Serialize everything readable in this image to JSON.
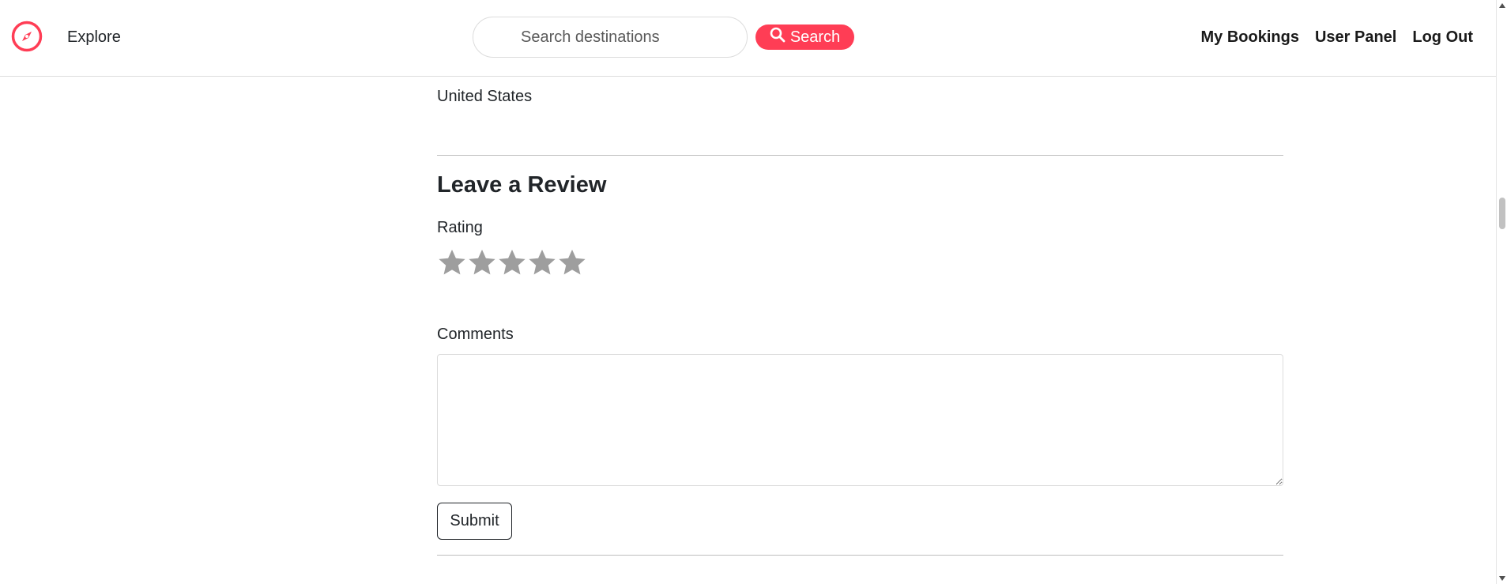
{
  "header": {
    "logo_icon": "compass-icon",
    "explore_label": "Explore",
    "search": {
      "placeholder": "Search destinations",
      "value": ""
    },
    "search_button_label": "Search",
    "search_button_icon": "search-icon",
    "nav_links": [
      "My Bookings",
      "User Panel",
      "Log Out"
    ]
  },
  "location": {
    "country": "United States"
  },
  "review": {
    "heading": "Leave a Review",
    "rating_label": "Rating",
    "rating_value": 0,
    "rating_max": 5,
    "comments_label": "Comments",
    "comments_value": "",
    "submit_label": "Submit"
  },
  "colors": {
    "accent": "#ff3d55",
    "star_inactive": "#9e9e9e",
    "text": "#212529"
  }
}
